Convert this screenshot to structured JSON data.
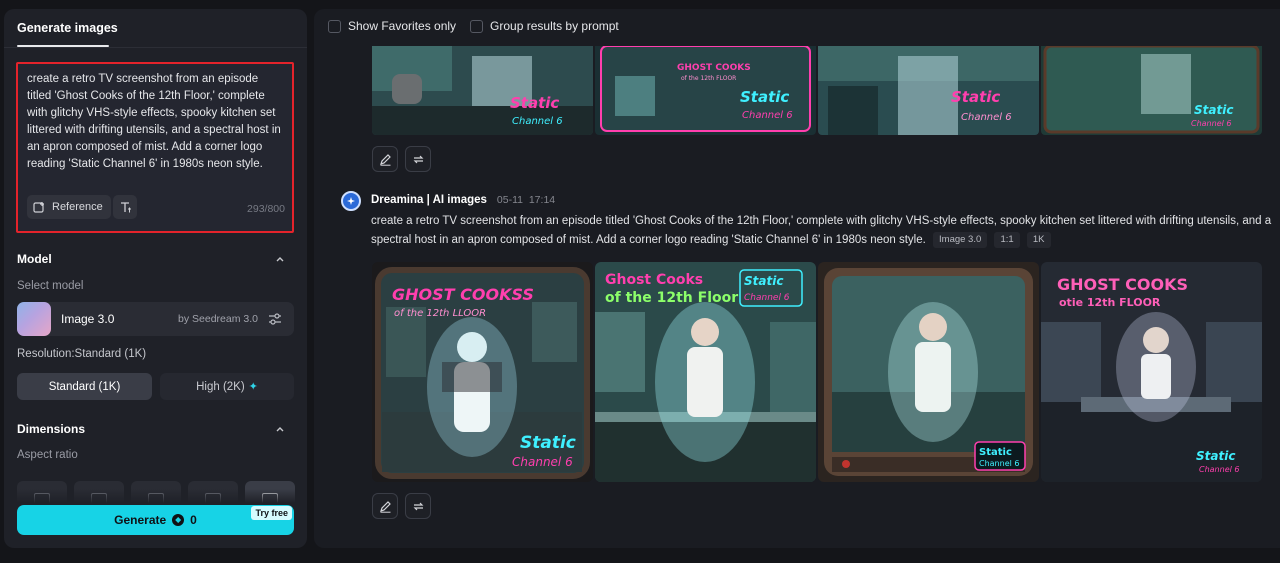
{
  "left_panel": {
    "tab": "Generate images",
    "prompt": "create a retro TV screenshot from an episode titled 'Ghost Cooks of the 12th Floor,' complete with glitchy VHS-style effects, spooky kitchen set littered with drifting utensils, and a spectral host in an apron composed of mist. Add a corner logo reading 'Static Channel 6' in 1980s neon style.",
    "reference_label": "Reference",
    "char_count": "293/800",
    "model_section": "Model",
    "select_model_label": "Select model",
    "model_name": "Image 3.0",
    "model_by": "by Seedream 3.0",
    "resolution_label": "Resolution:Standard (1K)",
    "resolution_options": [
      "Standard (1K)",
      "High (2K)"
    ],
    "dimensions_section": "Dimensions",
    "aspect_ratio_label": "Aspect ratio",
    "generate_label": "Generate",
    "credit_cost": "0",
    "try_free": "Try free"
  },
  "results": {
    "filters": [
      "Show Favorites only",
      "Group results by prompt"
    ],
    "entry": {
      "author": "Dreamina | AI images",
      "date": "05-11",
      "time": "17:14",
      "prompt": "create a retro TV screenshot from an episode titled 'Ghost Cooks of the 12th Floor,' complete with glitchy VHS-style effects, spooky kitchen set littered with drifting utensils, and a spectral host in an apron composed of mist. Add a corner logo reading 'Static Channel 6' in 1980s neon style.",
      "tags": [
        "Image 3.0",
        "1:1",
        "1K"
      ]
    },
    "images": [
      {
        "title": "GHOST COOKSS",
        "subtitle": "of the 12th LLOOR",
        "logo_1": "Static",
        "logo_2": "Channel 6"
      },
      {
        "title": "Ghost Cooks",
        "subtitle": "of the 12th Floor",
        "logo_1": "Static",
        "logo_2": "Channel 6"
      },
      {
        "title": "",
        "subtitle": "",
        "logo_1": "Static",
        "logo_2": "Channel 6"
      },
      {
        "title": "GHOST COOKS",
        "subtitle": "otie 12th FLOOR",
        "logo_1": "Static",
        "logo_2": "Channel 6"
      }
    ],
    "top_images": [
      {
        "logo_1": "Static",
        "logo_2": "Channel 6"
      },
      {
        "title": "GHOST COOKS",
        "subtitle": "of the 12th FLOOR",
        "logo_1": "Static",
        "logo_2": "Channel 6"
      },
      {
        "logo_1": "Static",
        "logo_2": "Channel 6"
      },
      {
        "logo_1": "Static",
        "logo_2": "Channel 6"
      }
    ]
  },
  "colors": {
    "accent": "#17d3e6",
    "neon_pink": "#ff3fae",
    "neon_cyan": "#3ff0ff",
    "highlight_border": "#e4232b"
  }
}
